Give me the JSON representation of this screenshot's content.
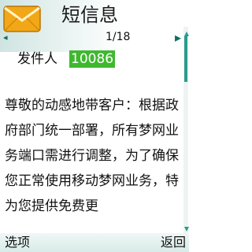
{
  "header": {
    "title": "短信息",
    "page_counter": "1/18",
    "nav_left_glyph": "◂",
    "nav_right_glyph": "▸",
    "icon": "envelope-icon"
  },
  "sender": {
    "label": "发件人",
    "number": "10086"
  },
  "message": {
    "body": "尊敬的动感地带客户：根据政府部门统一部署，所有梦网业务端口需进行调整，为了确保您正常使用移动梦网业务，特为您提供免费更"
  },
  "softkeys": {
    "left": "选项",
    "right": "返回"
  },
  "colors": {
    "highlight": "#3fb82f",
    "accent": "#2c9a8e",
    "envelope": "#f2a718"
  }
}
